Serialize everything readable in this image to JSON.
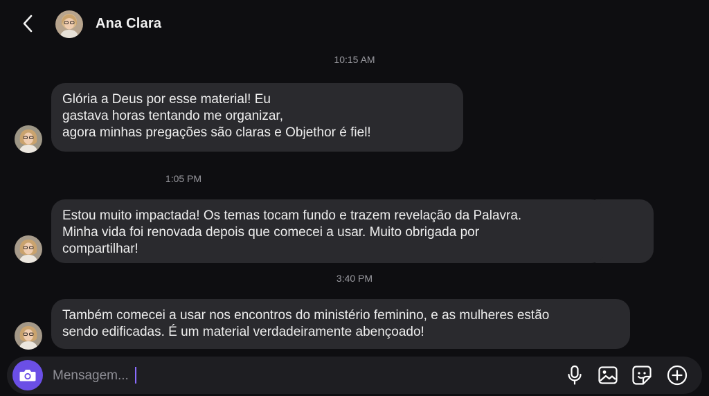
{
  "header": {
    "contact_name": "Ana Clara",
    "back_icon": "chevron-left-icon",
    "avatar_icon": "contact-avatar"
  },
  "conversation": [
    {
      "timestamp": "10:15 AM",
      "lines": [
        "Glória a Deus por esse material! Eu",
        "gastava horas tentando me organizar,",
        "agora minhas pregações são claras e Objethor é fiel!"
      ]
    },
    {
      "timestamp": "1:05 PM",
      "lines": [
        "Estou muito impactada! Os temas tocam fundo e trazem revelação da Palavra.",
        "Minha vida foi renovada depois que comecei a usar.  Muito obrigada por",
        "compartilhar!"
      ]
    },
    {
      "timestamp": "3:40 PM",
      "lines": [
        "Também comecei a usar nos encontros do ministério feminino, e as mulheres estão",
        "sendo edificadas. É um material verdadeiramente abençoado!"
      ]
    }
  ],
  "composer": {
    "placeholder": "Mensagem...",
    "value": "",
    "icons": [
      "camera-icon",
      "microphone-icon",
      "gallery-icon",
      "sticker-icon",
      "plus-circle-icon"
    ]
  },
  "colors": {
    "background": "#0e0e11",
    "bubble": "#2a2a2e",
    "accent": "#6b4fe6",
    "timestamp": "#9a9aa0"
  }
}
